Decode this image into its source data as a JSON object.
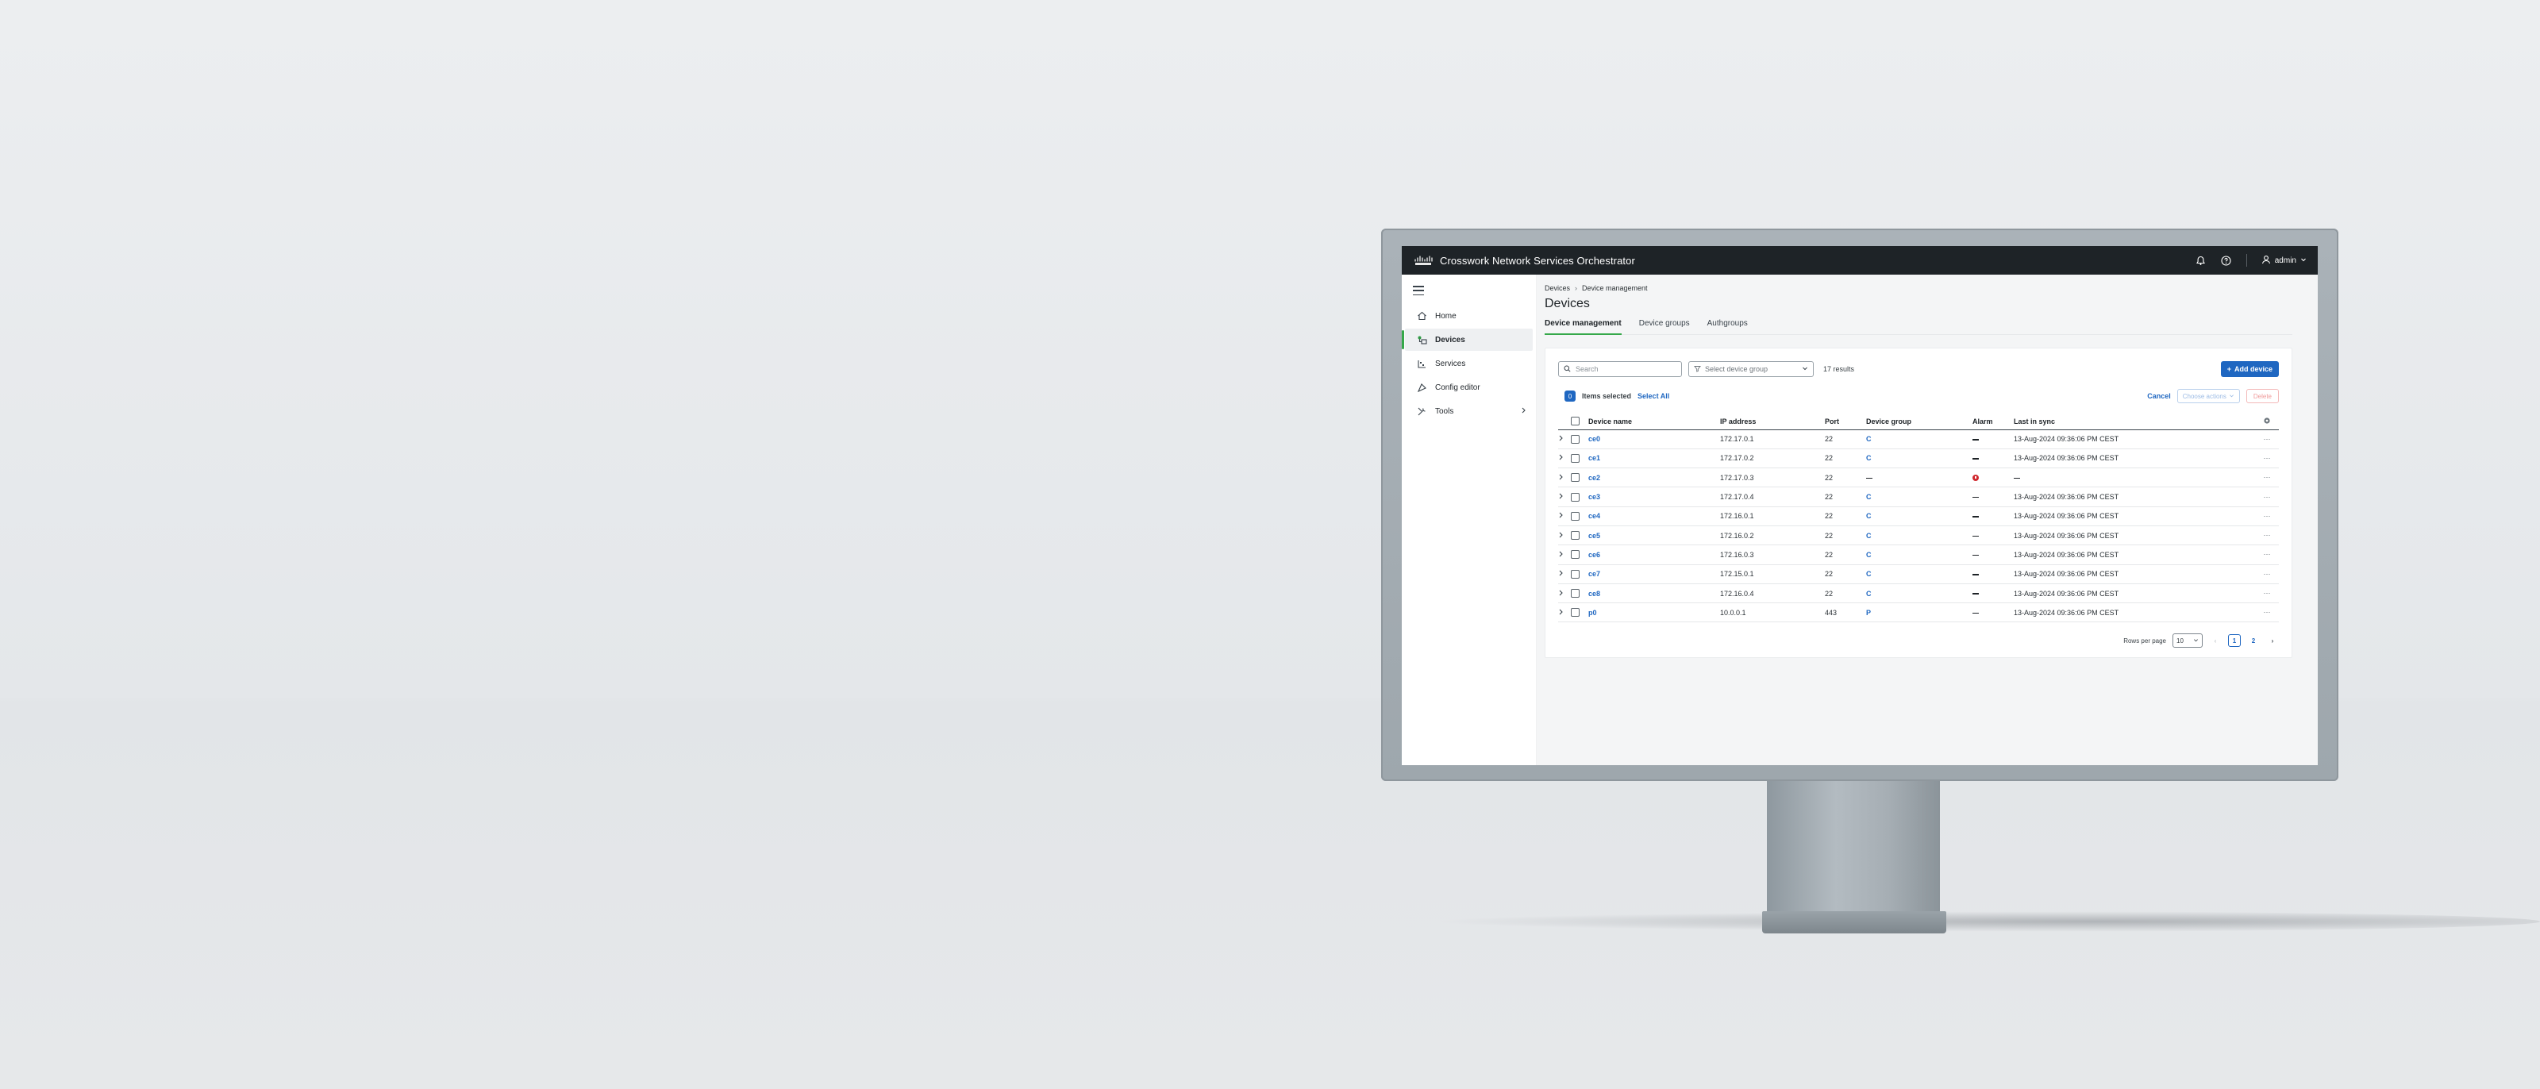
{
  "app": {
    "title": "Crosswork Network Services Orchestrator",
    "user": "admin",
    "accent_color": "#1f67c1",
    "active_color": "#36a84a"
  },
  "sidebar": {
    "items": [
      {
        "label": "Home",
        "icon": "home-icon"
      },
      {
        "label": "Devices",
        "icon": "devices-icon"
      },
      {
        "label": "Services",
        "icon": "services-icon"
      },
      {
        "label": "Config editor",
        "icon": "config-editor-icon"
      },
      {
        "label": "Tools",
        "icon": "tools-icon"
      }
    ]
  },
  "breadcrumb": {
    "root": "Devices",
    "current": "Device management"
  },
  "page_title": "Devices",
  "tabs": [
    "Device management",
    "Device groups",
    "Authgroups"
  ],
  "toolbar": {
    "search_placeholder": "Search",
    "device_group_placeholder": "Select device group",
    "results": "17 results",
    "add_label": "Add device"
  },
  "selection": {
    "count": "0",
    "text": "Items selected",
    "select_all": "Select All",
    "cancel": "Cancel",
    "choose_actions": "Choose actions",
    "delete": "Delete"
  },
  "table": {
    "headers": [
      "Device name",
      "IP address",
      "Port",
      "Device group",
      "Alarm",
      "Last in sync"
    ],
    "rows": [
      {
        "name": "ce0",
        "ip": "172.17.0.1",
        "port": "22",
        "group": "C",
        "alarm": "none",
        "sync": "13-Aug-2024 09:36:06 PM CEST"
      },
      {
        "name": "ce1",
        "ip": "172.17.0.2",
        "port": "22",
        "group": "C",
        "alarm": "none",
        "sync": "13-Aug-2024 09:36:06 PM CEST"
      },
      {
        "name": "ce2",
        "ip": "172.17.0.3",
        "port": "22",
        "group": "—",
        "alarm": "critical",
        "sync": "—"
      },
      {
        "name": "ce3",
        "ip": "172.17.0.4",
        "port": "22",
        "group": "C",
        "alarm": "none",
        "sync": "13-Aug-2024 09:36:06 PM CEST"
      },
      {
        "name": "ce4",
        "ip": "172.16.0.1",
        "port": "22",
        "group": "C",
        "alarm": "none",
        "sync": "13-Aug-2024 09:36:06 PM CEST"
      },
      {
        "name": "ce5",
        "ip": "172.16.0.2",
        "port": "22",
        "group": "C",
        "alarm": "none",
        "sync": "13-Aug-2024 09:36:06 PM CEST"
      },
      {
        "name": "ce6",
        "ip": "172.16.0.3",
        "port": "22",
        "group": "C",
        "alarm": "none",
        "sync": "13-Aug-2024 09:36:06 PM CEST"
      },
      {
        "name": "ce7",
        "ip": "172.15.0.1",
        "port": "22",
        "group": "C",
        "alarm": "none",
        "sync": "13-Aug-2024 09:36:06 PM CEST"
      },
      {
        "name": "ce8",
        "ip": "172.16.0.4",
        "port": "22",
        "group": "C",
        "alarm": "none",
        "sync": "13-Aug-2024 09:36:06 PM CEST"
      },
      {
        "name": "p0",
        "ip": "10.0.0.1",
        "port": "443",
        "group": "P",
        "alarm": "none",
        "sync": "13-Aug-2024 09:36:06 PM CEST"
      }
    ]
  },
  "pagination": {
    "rows_per_page_label": "Rows per page",
    "rows_per_page": "10",
    "pages": [
      "1",
      "2"
    ],
    "current_page": "1"
  }
}
